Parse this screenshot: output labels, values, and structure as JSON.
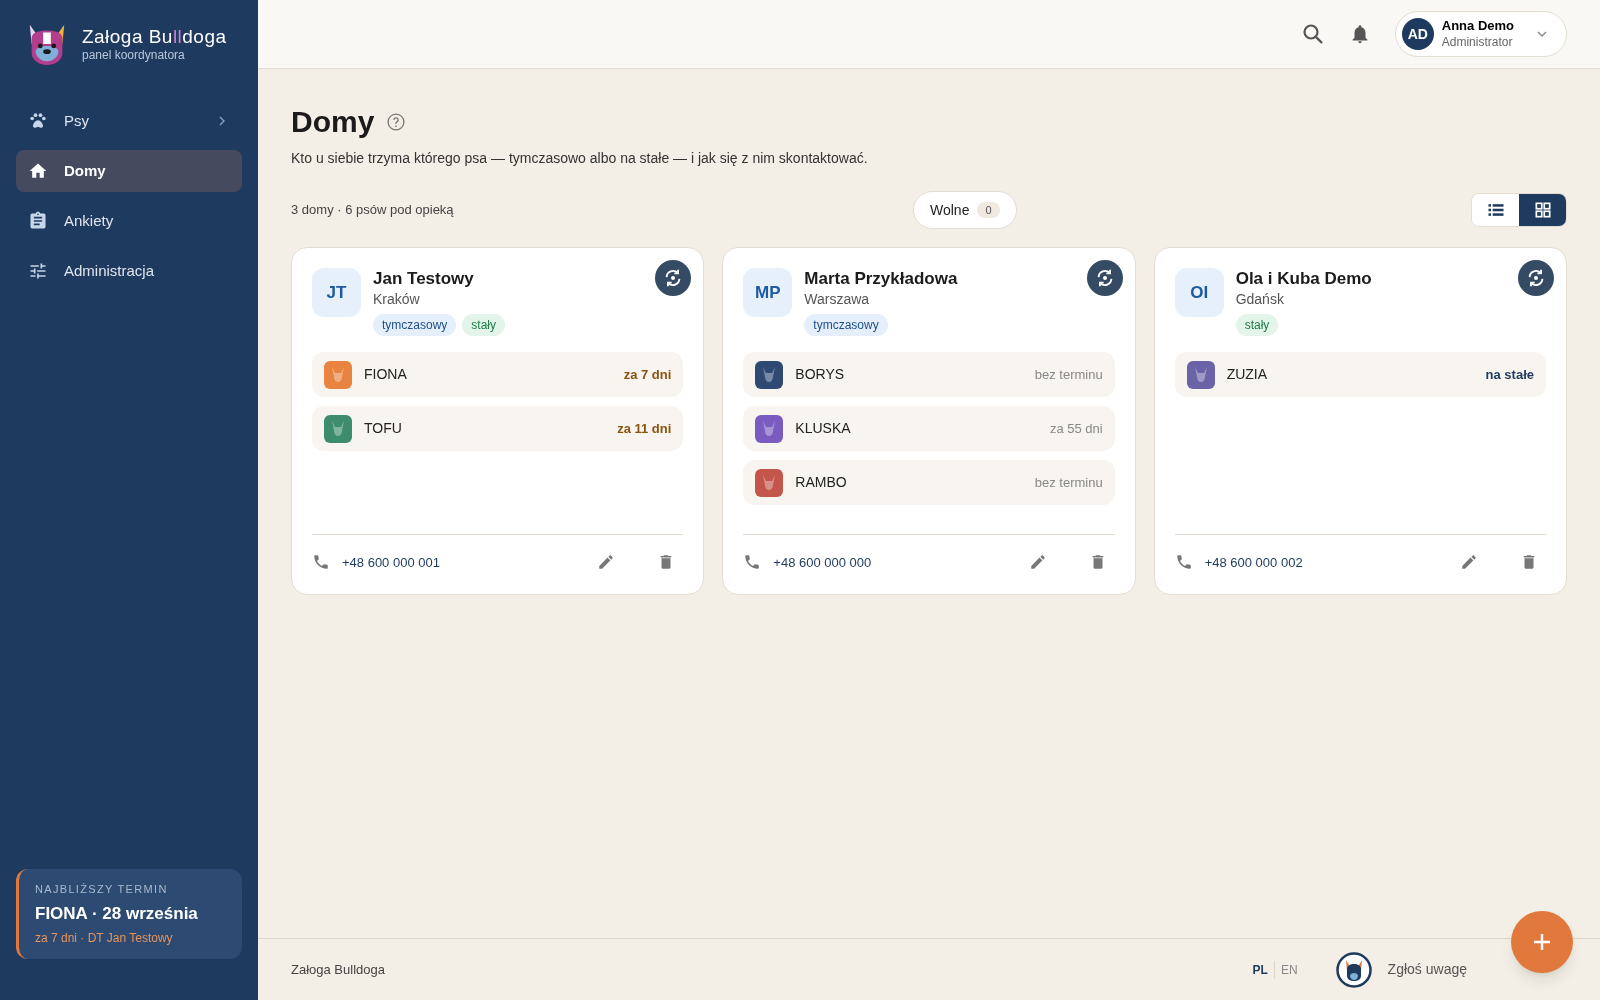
{
  "brand": {
    "name_start": "Załoga Bu",
    "name_accent": "ll",
    "name_end": "doga",
    "subtitle": "panel koordynatora"
  },
  "sidebar": {
    "items": [
      {
        "label": "Psy",
        "kind": "paw",
        "selected": false,
        "expandable": true
      },
      {
        "label": "Domy",
        "kind": "home",
        "selected": true,
        "expandable": false
      },
      {
        "label": "Ankiety",
        "kind": "clipboard",
        "selected": false,
        "expandable": false
      },
      {
        "label": "Administracja",
        "kind": "sliders",
        "selected": false,
        "expandable": false
      }
    ],
    "deadline": {
      "caption": "NAJBLIŻSZY TERMIN",
      "title": "FIONA · 28 września",
      "detail": "za 7 dni · DT Jan Testowy"
    }
  },
  "header": {
    "user": {
      "initials": "AD",
      "name": "Anna Demo",
      "role": "Administrator"
    }
  },
  "page": {
    "title": "Domy",
    "description": "Kto u siebie trzyma którego psa — tymczasowo albo na stałe — i jak się z nim skontaktować.",
    "summary": "3 domy · 6 psów pod opieką",
    "filter": {
      "label": "Wolne",
      "count": "0"
    },
    "views": [
      {
        "kind": "list",
        "selected": false
      },
      {
        "kind": "grid",
        "selected": true
      }
    ]
  },
  "homes": [
    {
      "initials": "JT",
      "name": "Jan Testowy",
      "city": "Kraków",
      "tags": [
        {
          "kind": "temporary",
          "label": "tymczasowy"
        },
        {
          "kind": "permanent",
          "label": "stały"
        }
      ],
      "dogs": [
        {
          "name": "FIONA",
          "color": "#e8843f",
          "due": "za 7 dni",
          "kind": "soon"
        },
        {
          "name": "TOFU",
          "color": "#3d8c6c",
          "due": "za 11 dni",
          "kind": "soon"
        }
      ],
      "phone": "+48 600 000 001"
    },
    {
      "initials": "MP",
      "name": "Marta Przykładowa",
      "city": "Warszawa",
      "tags": [
        {
          "kind": "temporary",
          "label": "tymczasowy"
        }
      ],
      "dogs": [
        {
          "name": "BORYS",
          "color": "#2e4a73",
          "due": "bez terminu",
          "kind": "none"
        },
        {
          "name": "KLUSKA",
          "color": "#7a5cc0",
          "due": "za 55 dni",
          "kind": "later"
        },
        {
          "name": "RAMBO",
          "color": "#c4554a",
          "due": "bez terminu",
          "kind": "none"
        }
      ],
      "phone": "+48 600 000 000"
    },
    {
      "initials": "OI",
      "name": "Ola i Kuba Demo",
      "city": "Gdańsk",
      "tags": [
        {
          "kind": "permanent",
          "label": "stały"
        }
      ],
      "dogs": [
        {
          "name": "ZUZIA",
          "color": "#6a63a8",
          "due": "na stałe",
          "kind": "permanent"
        }
      ],
      "phone": "+48 600 000 002"
    }
  ],
  "footer": {
    "brand": "Załoga Bulldoga",
    "languages": [
      {
        "code": "PL",
        "selected": true
      },
      {
        "code": "EN",
        "selected": false
      }
    ],
    "feedback": "Zgłoś uwagę"
  }
}
